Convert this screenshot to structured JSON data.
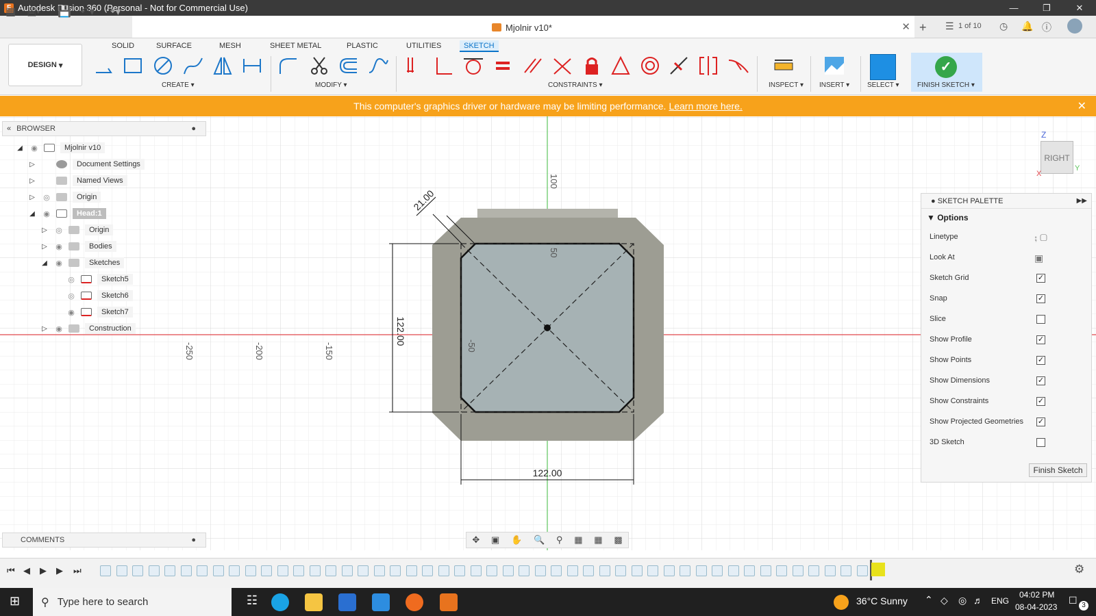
{
  "window": {
    "title": "Autodesk Fusion 360 (Personal - Not for Commercial Use)",
    "minimize": "—",
    "restore": "❐",
    "close": "✕"
  },
  "document": {
    "tab_name": "Mjolnir v10*",
    "version_badge": "1 of 10"
  },
  "ribbon": {
    "workspace": "DESIGN",
    "tabs": [
      "SOLID",
      "SURFACE",
      "MESH",
      "SHEET METAL",
      "PLASTIC",
      "UTILITIES",
      "SKETCH"
    ],
    "active_tab": "SKETCH",
    "groups": {
      "create": "CREATE",
      "modify": "MODIFY",
      "constraints": "CONSTRAINTS",
      "inspect": "INSPECT",
      "insert": "INSERT",
      "select": "SELECT",
      "finish": "FINISH SKETCH"
    }
  },
  "warning": {
    "text": "This computer's graphics driver or hardware may be limiting performance.",
    "link": "Learn more here."
  },
  "browser": {
    "title": "BROWSER",
    "items": [
      {
        "label": "Mjolnir v10",
        "level": 0,
        "expanded": true,
        "icon": "document-icon",
        "visible": true
      },
      {
        "label": "Document Settings",
        "level": 1,
        "expanded": false,
        "icon": "gear-icon",
        "visible": null
      },
      {
        "label": "Named Views",
        "level": 1,
        "expanded": false,
        "icon": "folder-icon",
        "visible": null
      },
      {
        "label": "Origin",
        "level": 1,
        "expanded": false,
        "icon": "folder-icon",
        "visible": false
      },
      {
        "label": "Head:1",
        "level": 1,
        "expanded": true,
        "icon": "component-icon",
        "visible": true
      },
      {
        "label": "Origin",
        "level": 2,
        "expanded": false,
        "icon": "folder-icon",
        "visible": false
      },
      {
        "label": "Bodies",
        "level": 2,
        "expanded": false,
        "icon": "folder-icon",
        "visible": true
      },
      {
        "label": "Sketches",
        "level": 2,
        "expanded": true,
        "icon": "folder-icon",
        "visible": true
      },
      {
        "label": "Sketch5",
        "level": 3,
        "expanded": null,
        "icon": "sketch-icon",
        "visible": false
      },
      {
        "label": "Sketch6",
        "level": 3,
        "expanded": null,
        "icon": "sketch-icon",
        "visible": false
      },
      {
        "label": "Sketch7",
        "level": 3,
        "expanded": null,
        "icon": "sketch-icon",
        "visible": true
      },
      {
        "label": "Construction",
        "level": 2,
        "expanded": false,
        "icon": "folder-icon",
        "visible": true
      }
    ]
  },
  "canvas": {
    "axis_ticks": {
      "x": [
        "-250",
        "-200",
        "-150"
      ],
      "y": [
        "100",
        "50",
        "-50"
      ]
    },
    "dimensions": {
      "width": "122.00",
      "height": "122.00",
      "chamfer": "21.00"
    }
  },
  "viewcube": {
    "face": "RIGHT",
    "z": "Z",
    "y": "Y",
    "x": "X"
  },
  "palette": {
    "title": "SKETCH PALETTE",
    "section": "Options",
    "rows": [
      {
        "label": "Linetype",
        "kind": "icons"
      },
      {
        "label": "Look At",
        "kind": "icon"
      },
      {
        "label": "Sketch Grid",
        "kind": "checkbox",
        "checked": true
      },
      {
        "label": "Snap",
        "kind": "checkbox",
        "checked": true
      },
      {
        "label": "Slice",
        "kind": "checkbox",
        "checked": false
      },
      {
        "label": "Show Profile",
        "kind": "checkbox",
        "checked": true
      },
      {
        "label": "Show Points",
        "kind": "checkbox",
        "checked": true
      },
      {
        "label": "Show Dimensions",
        "kind": "checkbox",
        "checked": true
      },
      {
        "label": "Show Constraints",
        "kind": "checkbox",
        "checked": true
      },
      {
        "label": "Show Projected Geometries",
        "kind": "checkbox",
        "checked": true
      },
      {
        "label": "3D Sketch",
        "kind": "checkbox",
        "checked": false
      }
    ],
    "finish_button": "Finish Sketch"
  },
  "comments": {
    "title": "COMMENTS"
  },
  "taskbar": {
    "search_placeholder": "Type here to search",
    "weather": "36°C  Sunny",
    "language": "ENG",
    "time": "04:02 PM",
    "date": "08-04-2023",
    "notification_count": "3"
  },
  "colors": {
    "accent": "#0a74c9",
    "warning": "#f7a21b",
    "finish": "#35a64a",
    "body": "#9d9d93",
    "sketch_fill": "#a6b2b4"
  }
}
